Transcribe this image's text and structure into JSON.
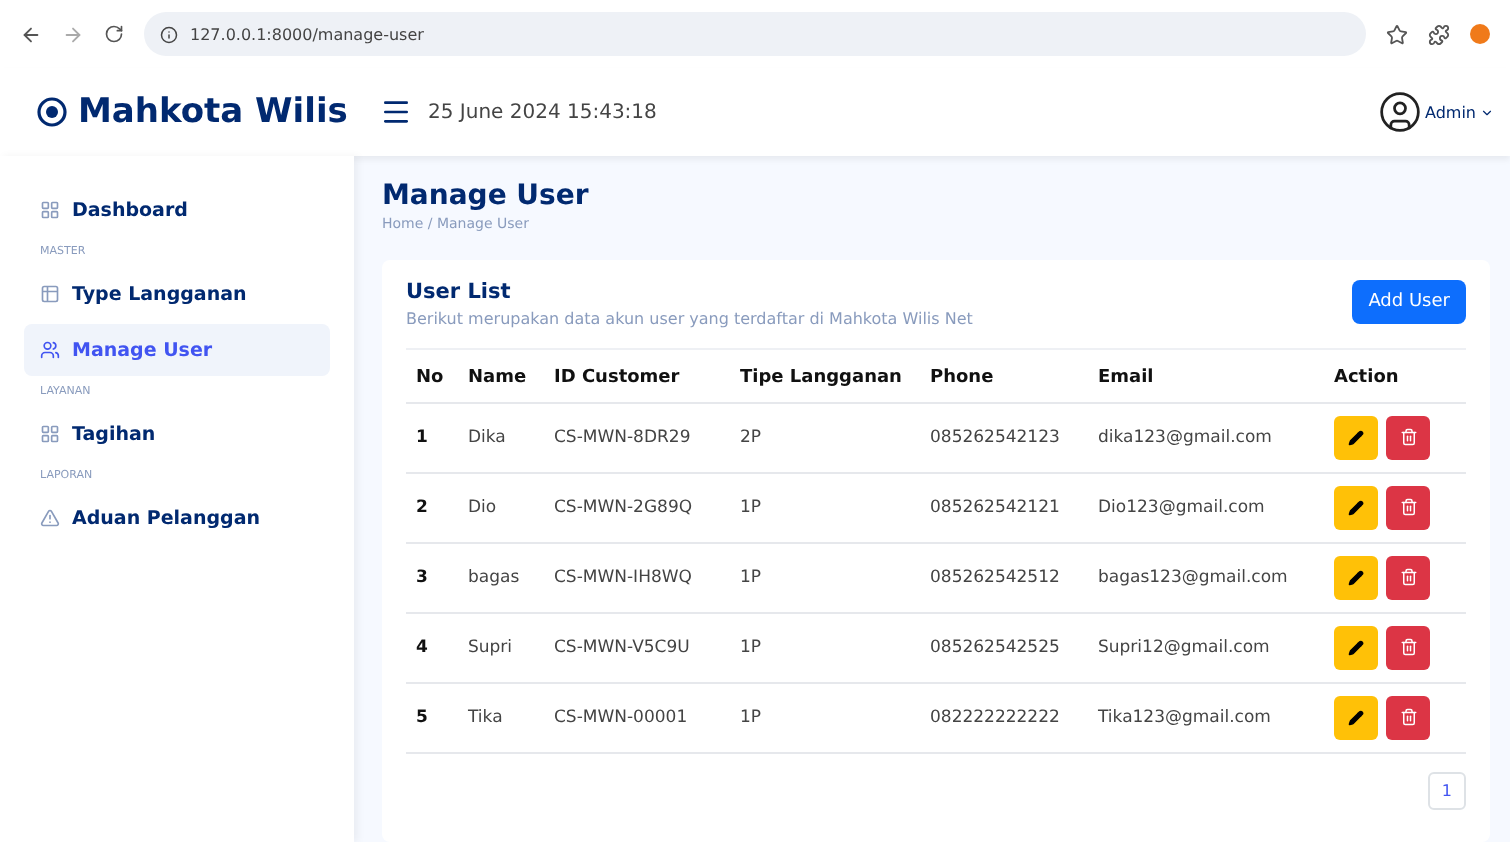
{
  "browser": {
    "url": "127.0.0.1:8000/manage-user"
  },
  "app": {
    "title": "Mahkota Wilis",
    "datetime": "25 June 2024 15:43:18",
    "user": "Admin"
  },
  "sidebar": {
    "items": [
      {
        "kind": "item",
        "label": "Dashboard",
        "selected": false
      },
      {
        "kind": "section",
        "label": "MASTER"
      },
      {
        "kind": "item",
        "label": "Type Langganan",
        "selected": false
      },
      {
        "kind": "item",
        "label": "Manage User",
        "selected": true
      },
      {
        "kind": "section",
        "label": "LAYANAN"
      },
      {
        "kind": "item",
        "label": "Tagihan",
        "selected": false
      },
      {
        "kind": "section",
        "label": "LAPORAN"
      },
      {
        "kind": "item",
        "label": "Aduan Pelanggan",
        "selected": false
      }
    ]
  },
  "page": {
    "title": "Manage User",
    "breadcrumb": "Home / Manage User"
  },
  "card": {
    "title": "User List",
    "subtitle": "Berikut merupakan data akun user yang terdaftar di Mahkota Wilis Net",
    "button": "Add User"
  },
  "table": {
    "columns": [
      "No",
      "Name",
      "ID Customer",
      "Tipe Langganan",
      "Phone",
      "Email",
      "Action"
    ],
    "rows": [
      [
        "1",
        "Dika",
        "CS-MWN-8DR29",
        "2P",
        "085262542123",
        "dika123@gmail.com"
      ],
      [
        "2",
        "Dio",
        "CS-MWN-2G89Q",
        "1P",
        "085262542121",
        "Dio123@gmail.com"
      ],
      [
        "3",
        "bagas",
        "CS-MWN-IH8WQ",
        "1P",
        "085262542512",
        "bagas123@gmail.com"
      ],
      [
        "4",
        "Supri",
        "CS-MWN-V5C9U",
        "1P",
        "085262542525",
        "Supri12@gmail.com"
      ],
      [
        "5",
        "Tika",
        "CS-MWN-00001",
        "1P",
        "082222222222",
        "Tika123@gmail.com"
      ]
    ]
  },
  "pagination": [
    "1"
  ]
}
